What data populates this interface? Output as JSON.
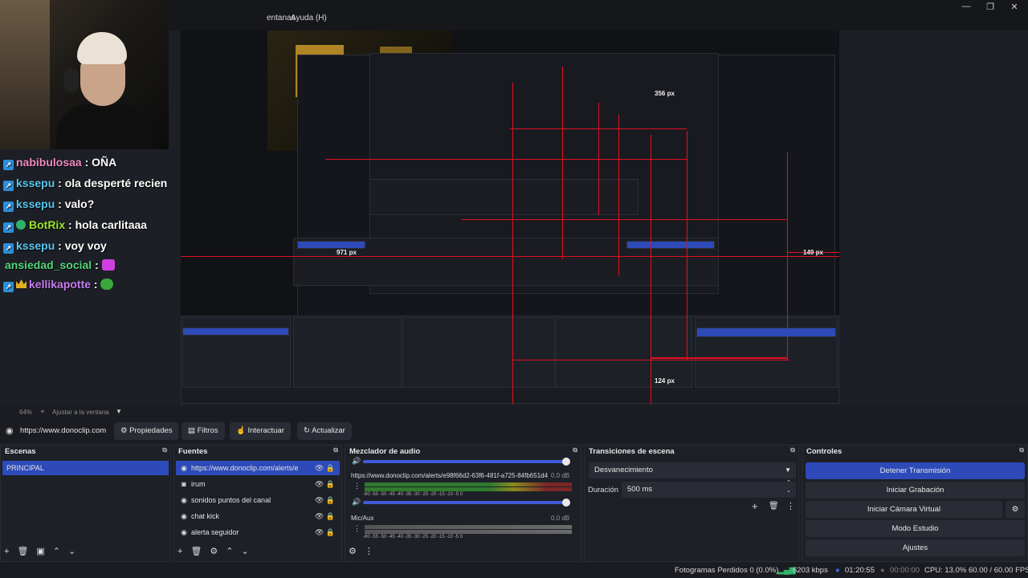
{
  "menu": {
    "ventanas": "entanas",
    "ayuda": "Ayuda (H)"
  },
  "window_controls": {
    "minimize": "—",
    "maximize": "❐",
    "close": "✕"
  },
  "preview_overlay": {
    "label_356": "356 px",
    "label_149": "149 px",
    "label_971": "971 px",
    "label_124": "124 px"
  },
  "chat": [
    {
      "user": "nabibulosaa",
      "user_color": "#f08cc0",
      "message": ": OÑA"
    },
    {
      "user": "kssepu",
      "user_color": "#59c7f0",
      "message": ": ola desperté recien"
    },
    {
      "user": "kssepu",
      "user_color": "#59c7f0",
      "message": ": valo?"
    },
    {
      "user": "BotRix",
      "user_color": "#9be52a",
      "message": ": hola carlitaaa"
    },
    {
      "user": "kssepu",
      "user_color": "#59c7f0",
      "message": ": voy voy"
    },
    {
      "user": "ansiedad_social",
      "user_color": "#50d77a",
      "message": ":"
    },
    {
      "user": "kellikapotte",
      "user_color": "#c57ef0",
      "message": ":"
    }
  ],
  "zoom": {
    "level": "64%",
    "fit_label": "Ajustar a la ventana",
    "plus": "+"
  },
  "toolbar": {
    "source_name": "https://www.donoclip.com",
    "properties": "Propiedades",
    "filters": "Filtros",
    "interact": "Interactuar",
    "refresh": "Actualizar"
  },
  "scenes": {
    "title": "Escenas",
    "items": [
      "PRINCIPAL"
    ]
  },
  "sources": {
    "title": "Fuentes",
    "items": [
      {
        "label": "https://www.donoclip.com/alerts/e",
        "icon": "globe-icon"
      },
      {
        "label": "irum",
        "icon": "camera-icon"
      },
      {
        "label": "sonidos puntos del canal",
        "icon": "globe-icon"
      },
      {
        "label": "chat kick",
        "icon": "globe-icon"
      },
      {
        "label": "alerta seguidor",
        "icon": "globe-icon"
      }
    ]
  },
  "mixer": {
    "title": "Mezclador de audio",
    "track1": {
      "name": "https://www.donoclip.com/alerts/e98f66d2-63f6-481f-a725-84fb651d48d0",
      "db": "0.0 dB",
      "level": 0.92
    },
    "track2": {
      "name": "Mic/Aux",
      "db": "0.0 dB",
      "level": 0.0
    },
    "scale": [
      "-60",
      "-55",
      "-50",
      "-45",
      "-40",
      "-35",
      "-30",
      "-25",
      "-20",
      "-15",
      "-10",
      "-5",
      "0"
    ]
  },
  "transitions": {
    "title": "Transiciones de escena",
    "selected": "Desvanecimiento",
    "duration_label": "Duración",
    "duration_value": "500 ms"
  },
  "controls": {
    "title": "Controles",
    "stop_stream": "Detener Transmisión",
    "start_recording": "Iniciar Grabación",
    "start_virtual_cam": "Iniciar Cámara Virtual",
    "studio_mode": "Modo Estudio",
    "settings": "Ajustes"
  },
  "status": {
    "dropped_frames": "Fotogramas Perdidos 0 (0.0%)",
    "bitrate": "6203 kbps",
    "stream_time": "01:20:55",
    "rec_time": "00:00:00",
    "cpu": "CPU: 13.0%",
    "fps": "60.00 / 60.00 FPS"
  },
  "colors": {
    "accent": "#2d4ab8",
    "guide_red": "#e01020",
    "live_green": "#2fb36b"
  }
}
